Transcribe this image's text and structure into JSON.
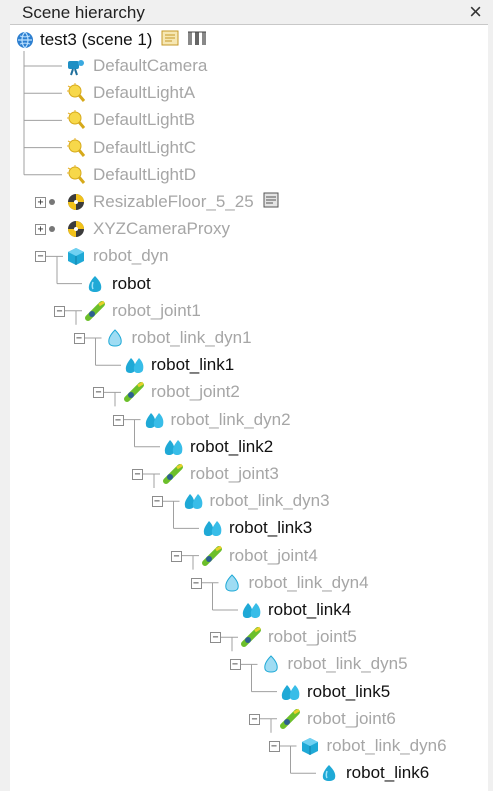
{
  "panel": {
    "title": "Scene hierarchy",
    "close_glyph": "×"
  },
  "root": {
    "label": "test3 (scene 1)",
    "icon": "globe-icon"
  },
  "items": [
    {
      "label": "DefaultCamera",
      "icon": "camera-icon",
      "style": "dim"
    },
    {
      "label": "DefaultLightA",
      "icon": "light-bulb-icon",
      "style": "dim"
    },
    {
      "label": "DefaultLightB",
      "icon": "light-bulb-icon",
      "style": "dim"
    },
    {
      "label": "DefaultLightC",
      "icon": "light-bulb-icon",
      "style": "dim"
    },
    {
      "label": "DefaultLightD",
      "icon": "light-bulb-icon",
      "style": "dim"
    },
    {
      "label": "ResizableFloor_5_25",
      "icon": "dummy-ball-icon",
      "style": "dim"
    },
    {
      "label": "XYZCameraProxy",
      "icon": "dummy-ball-icon",
      "style": "dim"
    },
    {
      "label": "robot_dyn",
      "icon": "cuboid-icon",
      "style": "dim"
    },
    {
      "label": "robot",
      "icon": "shape-blob-icon",
      "style": "bold"
    },
    {
      "label": "robot_joint1",
      "icon": "joint-icon",
      "style": "dim"
    },
    {
      "label": "robot_link_dyn1",
      "icon": "shape-drop-icon",
      "style": "dim"
    },
    {
      "label": "robot_link1",
      "icon": "shape-multi-icon",
      "style": "bold"
    },
    {
      "label": "robot_joint2",
      "icon": "joint-icon",
      "style": "dim"
    },
    {
      "label": "robot_link_dyn2",
      "icon": "shape-multi-icon",
      "style": "dim"
    },
    {
      "label": "robot_link2",
      "icon": "shape-multi-icon",
      "style": "bold"
    },
    {
      "label": "robot_joint3",
      "icon": "joint-icon",
      "style": "dim"
    },
    {
      "label": "robot_link_dyn3",
      "icon": "shape-multi-icon",
      "style": "dim"
    },
    {
      "label": "robot_link3",
      "icon": "shape-multi-icon",
      "style": "bold"
    },
    {
      "label": "robot_joint4",
      "icon": "joint-icon",
      "style": "dim"
    },
    {
      "label": "robot_link_dyn4",
      "icon": "shape-drop-icon",
      "style": "dim"
    },
    {
      "label": "robot_link4",
      "icon": "shape-multi-icon",
      "style": "bold"
    },
    {
      "label": "robot_joint5",
      "icon": "joint-icon",
      "style": "dim"
    },
    {
      "label": "robot_link_dyn5",
      "icon": "shape-drop-icon",
      "style": "dim"
    },
    {
      "label": "robot_link5",
      "icon": "shape-multi-icon",
      "style": "bold"
    },
    {
      "label": "robot_joint6",
      "icon": "joint-icon",
      "style": "dim"
    },
    {
      "label": "robot_link_dyn6",
      "icon": "cuboid-icon",
      "style": "dim"
    },
    {
      "label": "robot_link6",
      "icon": "shape-blob-icon",
      "style": "bold"
    }
  ],
  "colors": {
    "dim_text": "#a6a6a6",
    "bold_text": "#111111",
    "tree_line": "#a0a0a0",
    "shape_cyan": "#1fa9d6",
    "joint_green": "#6cbf2b",
    "light_yellow": "#f2d23a"
  }
}
